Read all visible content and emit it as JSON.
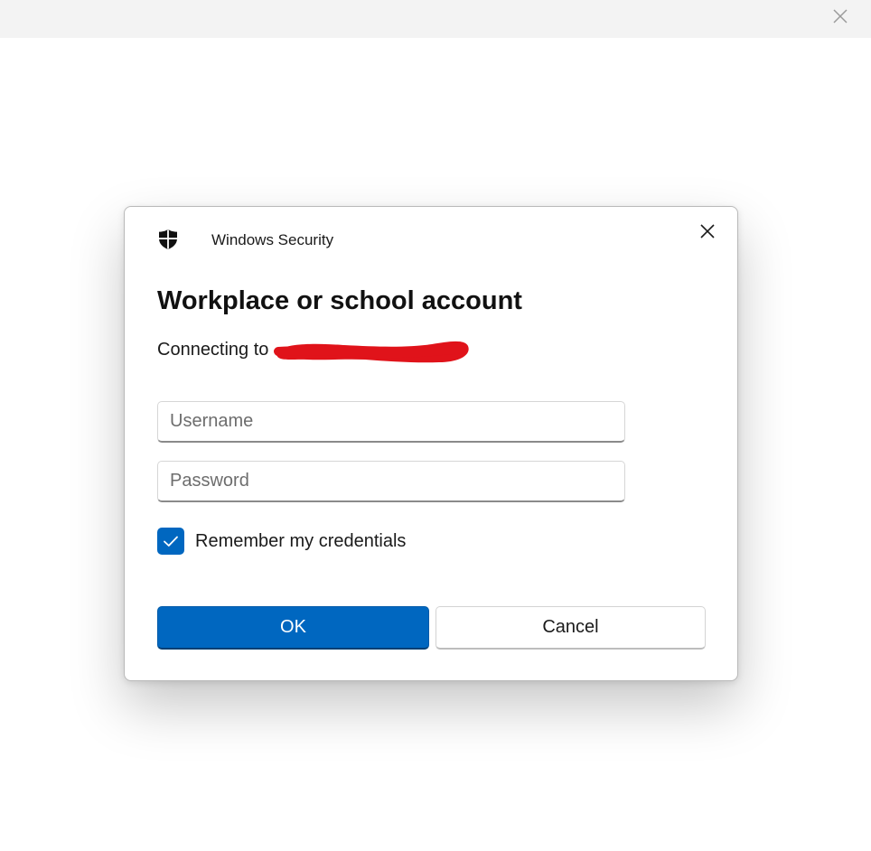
{
  "window": {
    "close_icon": "close-icon"
  },
  "dialog": {
    "app_name": "Windows Security",
    "app_icon": "shield-icon",
    "close_icon": "close-icon",
    "title": "Workplace or school account",
    "connecting_text": "Connecting to",
    "username": {
      "placeholder": "Username",
      "value": ""
    },
    "password": {
      "placeholder": "Password",
      "value": ""
    },
    "remember": {
      "label": "Remember my credentials",
      "checked": true
    },
    "buttons": {
      "ok": "OK",
      "cancel": "Cancel"
    }
  },
  "colors": {
    "accent": "#0067c0",
    "redaction": "#e0131a"
  }
}
